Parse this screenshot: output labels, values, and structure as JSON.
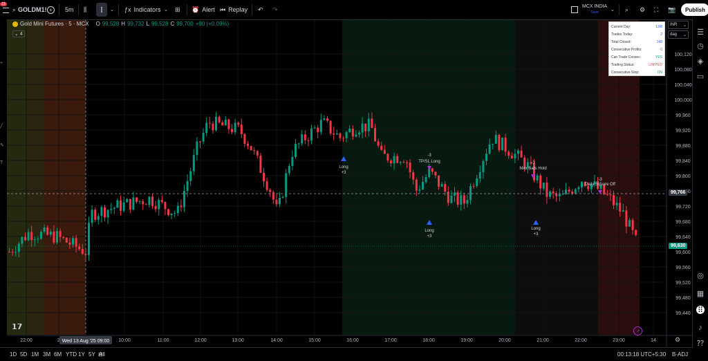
{
  "topbar": {
    "notif_badge": "13",
    "symbol": "GOLDM1!",
    "interval": "5m",
    "indicators_label": "Indicators",
    "alert_label": "Alert",
    "replay_label": "Replay",
    "exchange_title": "MCX INDIA",
    "save_label": "Save",
    "publish_label": "Publish"
  },
  "legend": {
    "title": "Gold Mini Futures · 5 · MCX",
    "o_label": "O",
    "o_value": "99,528",
    "h_label": "H",
    "h_value": "99,732",
    "l_label": "L",
    "l_value": "99,528",
    "c_label": "C",
    "c_value": "99,700",
    "change": "+90 (+0.09%)",
    "collapse_count": "4"
  },
  "stats_panel": {
    "rows": [
      {
        "label": "Current Day:",
        "value": "13/8",
        "color": "#2962ff"
      },
      {
        "label": "Trades Today:",
        "value": "2",
        "color": "#2962ff"
      },
      {
        "label": "Total Closed:",
        "value": "148",
        "color": "#2962ff"
      },
      {
        "label": "Consecutive Profits:",
        "value": "0",
        "color": "#089981"
      },
      {
        "label": "Can Trade Consec:",
        "value": "YES",
        "color": "#089981"
      },
      {
        "label": "Trading Status:",
        "value": "LIMITED",
        "color": "#f23645"
      },
      {
        "label": "Consecutive Stop:",
        "value": "ON",
        "color": "#089981"
      }
    ]
  },
  "price_scale": {
    "currency": "INR",
    "unit": "dag",
    "labels": [
      "100,120",
      "100,080",
      "100,040",
      "100,000",
      "99,960",
      "99,920",
      "99,880",
      "99,840",
      "99,800",
      "99,760",
      "99,720",
      "99,680",
      "99,640",
      "99,600",
      "99,560",
      "99,520",
      "99,480",
      "99,440"
    ],
    "crosshair_price": "99,766",
    "last_price": "99,630"
  },
  "time_axis": {
    "labels": [
      "22:00",
      "2",
      "10:00",
      "11:00",
      "12:00",
      "13:00",
      "14:00",
      "15:00",
      "16:00",
      "17:00",
      "18:00",
      "19:00",
      "20:00",
      "21:00",
      "22:00",
      "23:00",
      "14"
    ],
    "crosshair_label": "Wed 13 Aug '25   09:00"
  },
  "annotations": [
    {
      "id": "long1",
      "text": "Long",
      "sub": "+3"
    },
    {
      "id": "tpsl",
      "top": "-3",
      "text": "TP/SL Long"
    },
    {
      "id": "long2",
      "text": "Long",
      "sub": "+3"
    },
    {
      "id": "maxbars",
      "top": "-3",
      "text": "Max Bars Hold"
    },
    {
      "id": "long3",
      "text": "Long",
      "sub": "+3"
    },
    {
      "id": "daily",
      "top": "-3",
      "text": "Daily Square Off"
    }
  ],
  "bottombar": {
    "ranges": [
      "1D",
      "5D",
      "1M",
      "3M",
      "6M",
      "YTD",
      "1Y",
      "5Y",
      "All"
    ],
    "clock": "00:13:18 UTC+5:30",
    "adj": "B-ADJ"
  },
  "colors": {
    "up": "#089981",
    "down": "#f23645",
    "accent": "#2962ff",
    "session_green": "#0b1f14",
    "session_red": "#2a0d0d"
  },
  "chart_data": {
    "type": "candlestick",
    "interval": "5m",
    "ylim": [
      99400,
      100160
    ],
    "crosshair_price": 99766,
    "last_price": 99630,
    "legend_last": {
      "open": 99528,
      "high": 99732,
      "low": 99528,
      "close": 99700
    }
  }
}
